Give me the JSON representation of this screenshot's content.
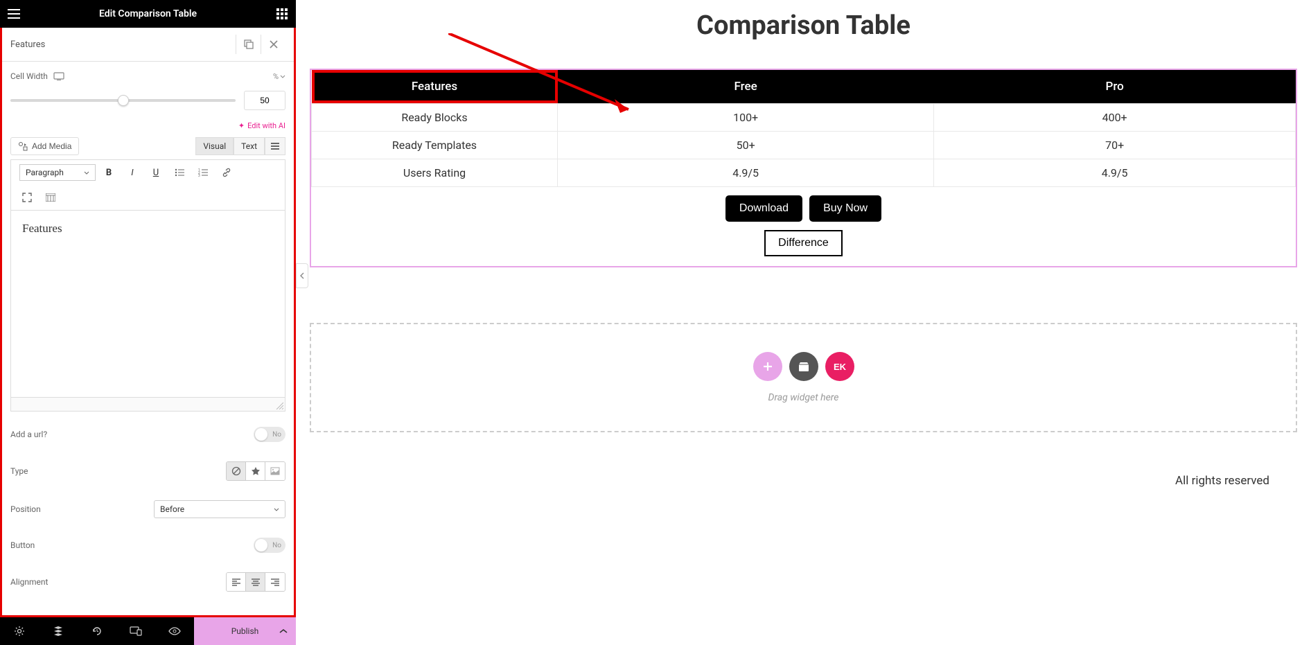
{
  "sidebar": {
    "title": "Edit Comparison Table",
    "accordion_title": "Features",
    "cell_width_label": "Cell Width",
    "cell_width_unit": "%",
    "cell_width_value": "50",
    "edit_ai_label": "Edit with AI",
    "add_media_label": "Add Media",
    "tabs": {
      "visual": "Visual",
      "text": "Text"
    },
    "format_select": "Paragraph",
    "editor_content": "Features",
    "add_url_label": "Add a url?",
    "add_url_value": "No",
    "type_label": "Type",
    "position_label": "Position",
    "position_value": "Before",
    "button_label": "Button",
    "button_value": "No",
    "alignment_label": "Alignment"
  },
  "bottombar": {
    "publish": "Publish"
  },
  "canvas": {
    "page_title": "Comparison Table",
    "headers": [
      "Features",
      "Free",
      "Pro"
    ],
    "rows": [
      [
        "Ready Blocks",
        "100+",
        "400+"
      ],
      [
        "Ready Templates",
        "50+",
        "70+"
      ],
      [
        "Users Rating",
        "4.9/5",
        "4.9/5"
      ]
    ],
    "download_btn": "Download",
    "buy_btn": "Buy Now",
    "diff_btn": "Difference",
    "drop_text": "Drag widget here",
    "footer": "All rights reserved"
  }
}
